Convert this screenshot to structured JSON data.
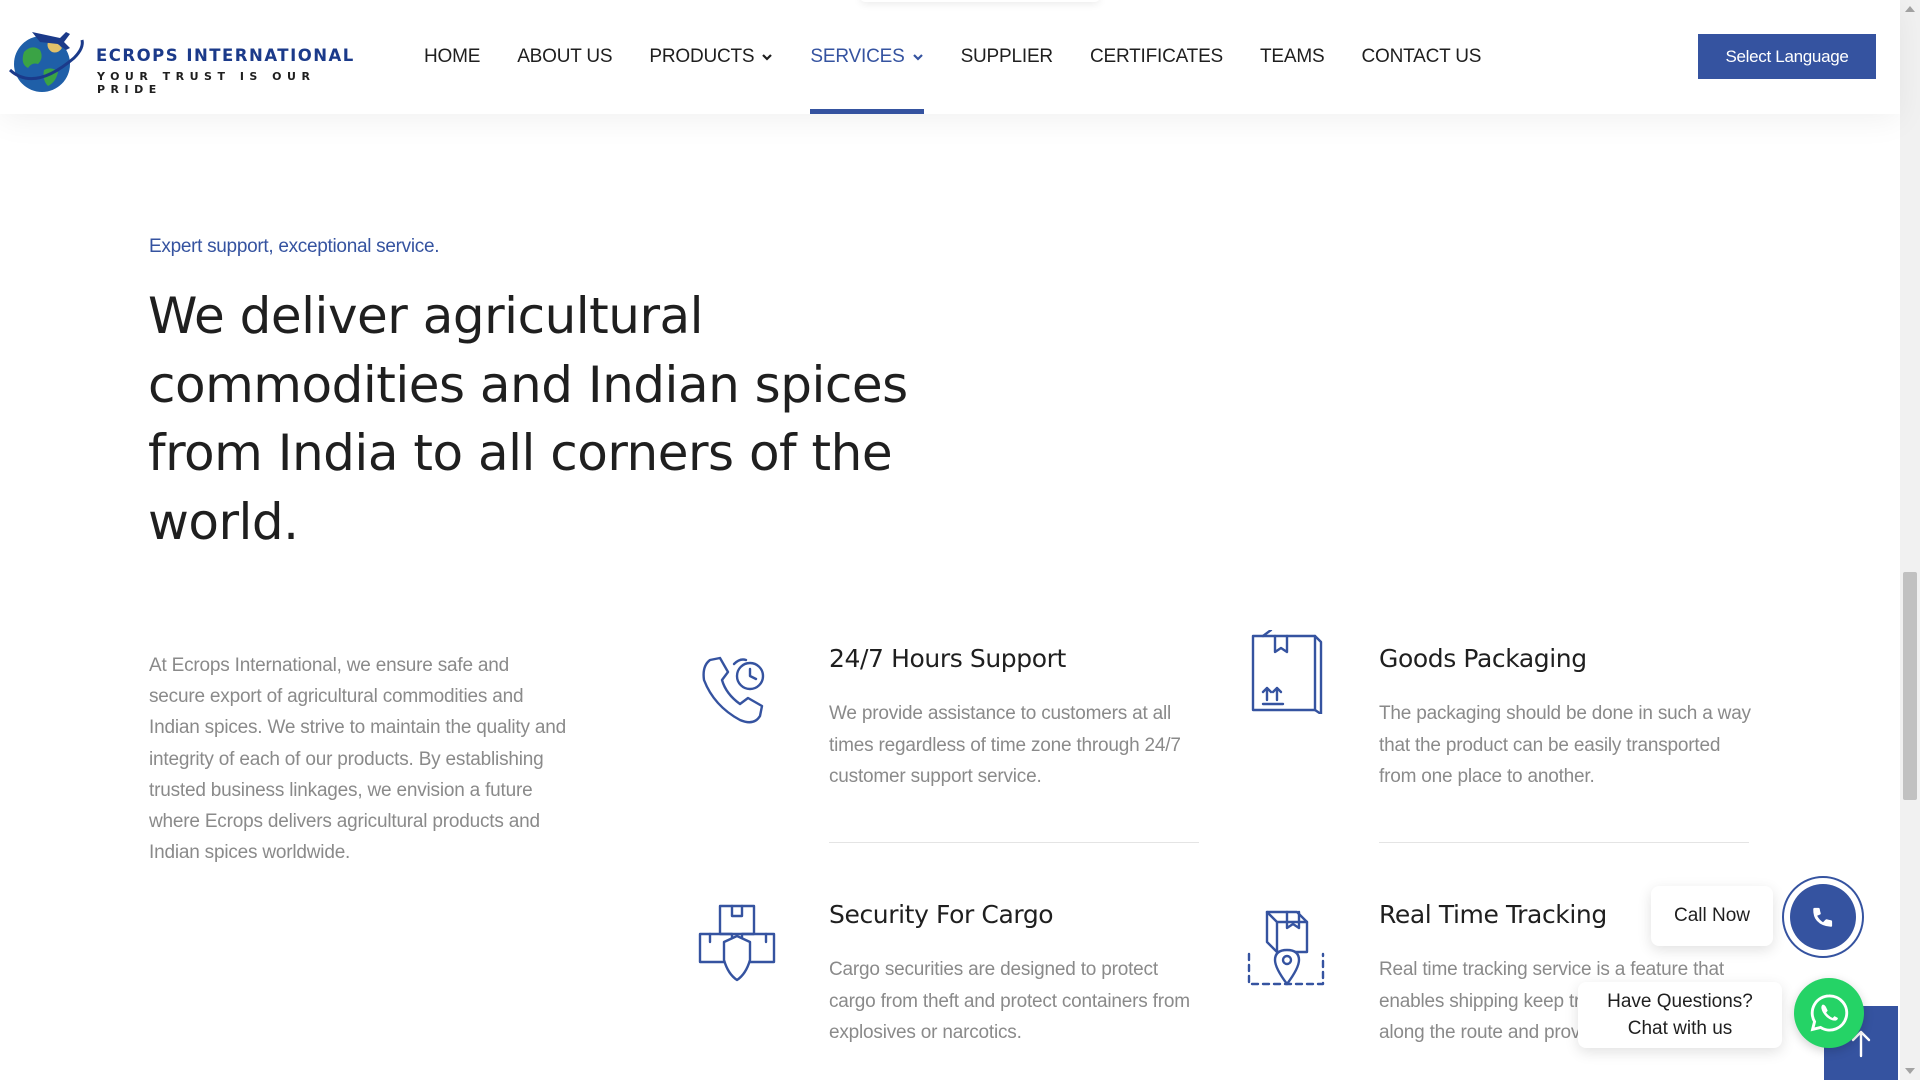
{
  "header": {
    "brand": "ECROPS INTERNATIONAL",
    "tagline": "YOUR TRUST IS OUR PRIDE",
    "nav": [
      {
        "label": "HOME",
        "dropdown": false,
        "active": false
      },
      {
        "label": "ABOUT US",
        "dropdown": false,
        "active": false
      },
      {
        "label": "PRODUCTS",
        "dropdown": true,
        "active": false
      },
      {
        "label": "SERVICES",
        "dropdown": true,
        "active": true
      },
      {
        "label": "SUPPLIER",
        "dropdown": false,
        "active": false
      },
      {
        "label": "CERTIFICATES",
        "dropdown": false,
        "active": false
      },
      {
        "label": "TEAMS",
        "dropdown": false,
        "active": false
      },
      {
        "label": "CONTACT US",
        "dropdown": false,
        "active": false
      }
    ],
    "language_button": "Select Language"
  },
  "hero": {
    "eyebrow": "Expert support, exceptional service.",
    "headline": "We deliver agricultural commodities and Indian spices from India to all corners of the world.",
    "intro": "At Ecrops International, we ensure safe and secure export of agricultural commodities and Indian spices. We strive to maintain the quality and integrity of each of our products. By establishing trusted business linkages, we envision a future where Ecrops delivers agricultural products and Indian spices worldwide."
  },
  "features": [
    {
      "title": "24/7 Hours Support",
      "desc": "We provide assistance to customers at all times regardless of time zone through 24/7 customer support service.",
      "icon": "phone-clock-icon"
    },
    {
      "title": "Goods Packaging",
      "desc": "The packaging should be done in such a way that the product can be easily transported from one place to another.",
      "icon": "box-package-icon"
    },
    {
      "title": "Security For Cargo",
      "desc": "Cargo securities are designed to protect cargo from theft and protect containers from explosives or narcotics.",
      "icon": "cargo-shield-icon"
    },
    {
      "title": "Real Time Tracking",
      "desc": "Real time tracking service is a feature that enables shipping keep track of all shipr them along the route and provide",
      "icon": "tracking-location-icon"
    }
  ],
  "widgets": {
    "call_label": "Call Now",
    "chat_line1": "Have Questions?",
    "chat_line2": "Chat with us"
  },
  "colors": {
    "brand_blue": "#3553a0",
    "whatsapp_green": "#25d366",
    "body_text": "#8a8a8a"
  }
}
